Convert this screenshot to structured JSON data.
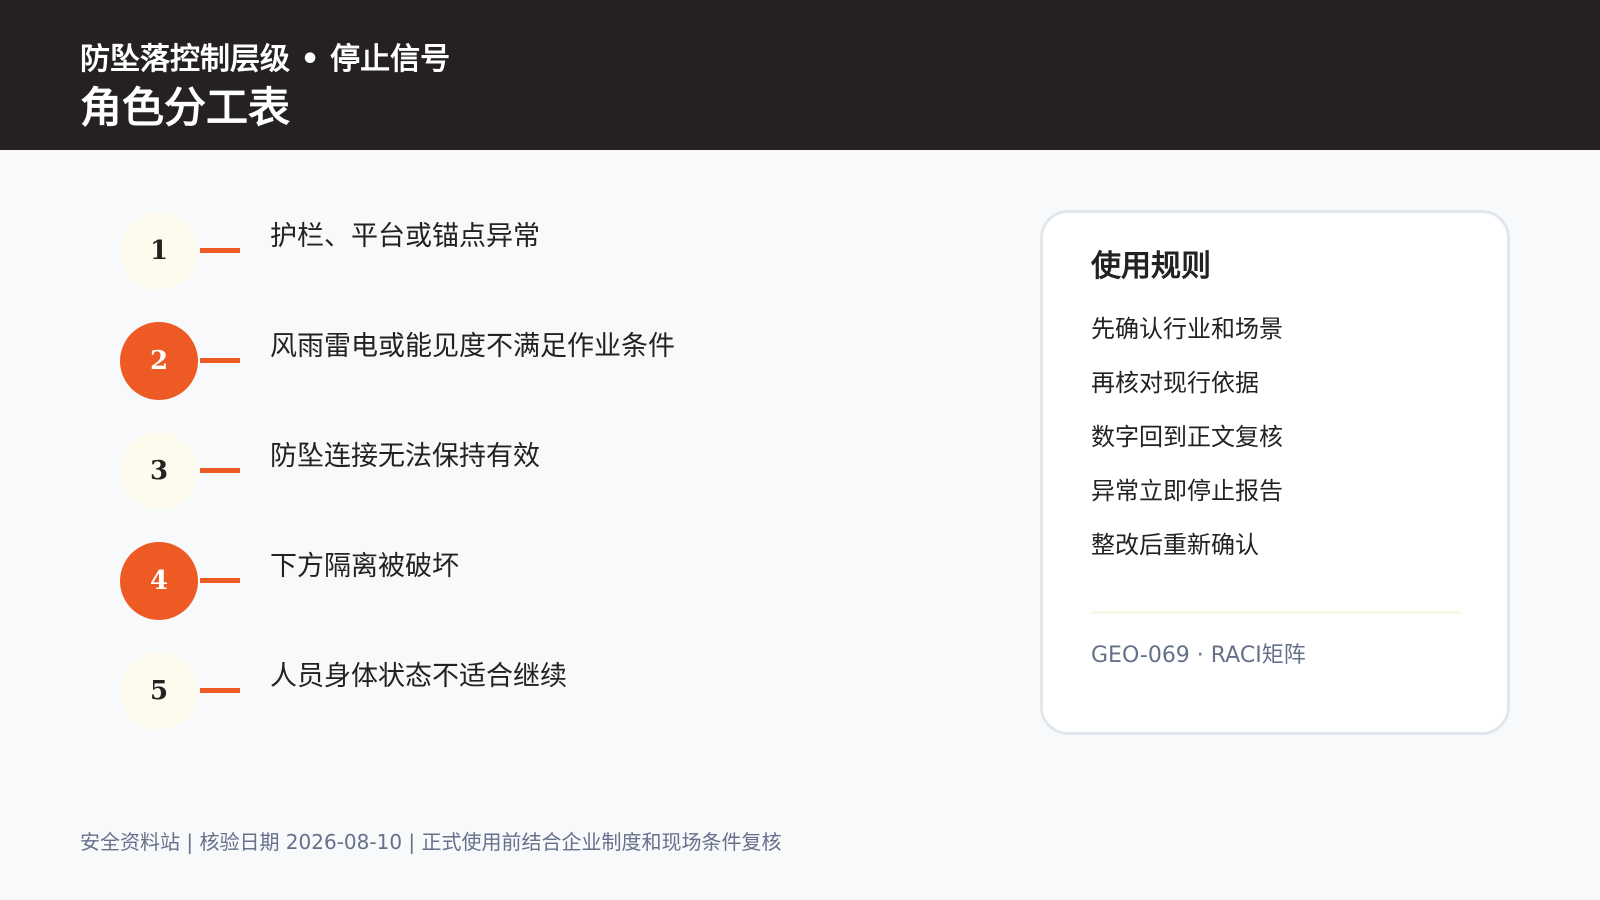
{
  "header": {
    "subtitle": "防坠落控制层级 • 停止信号",
    "title": "角色分工表"
  },
  "steps": [
    {
      "number": "1",
      "text": "护栏、平台或锚点异常",
      "style": "light"
    },
    {
      "number": "2",
      "text": "风雨雷电或能见度不满足作业条件",
      "style": "accent"
    },
    {
      "number": "3",
      "text": "防坠连接无法保持有效",
      "style": "light"
    },
    {
      "number": "4",
      "text": "下方隔离被破坏",
      "style": "accent"
    },
    {
      "number": "5",
      "text": "人员身体状态不适合继续",
      "style": "light"
    }
  ],
  "panel": {
    "title": "使用规则",
    "rules": [
      "先确认行业和场景",
      "再核对现行依据",
      "数字回到正文复核",
      "异常立即停止报告",
      "整改后重新确认"
    ],
    "reference": "GEO-069 · RACI矩阵"
  },
  "footer": {
    "text": "安全资料站 | 核验日期 2026-08-10 | 正式使用前结合企业制度和现场条件复核"
  },
  "colors": {
    "header_bg": "#242120",
    "accent": "#ee5a24",
    "light_circle": "#fdfbee",
    "muted_text": "#66708a"
  }
}
